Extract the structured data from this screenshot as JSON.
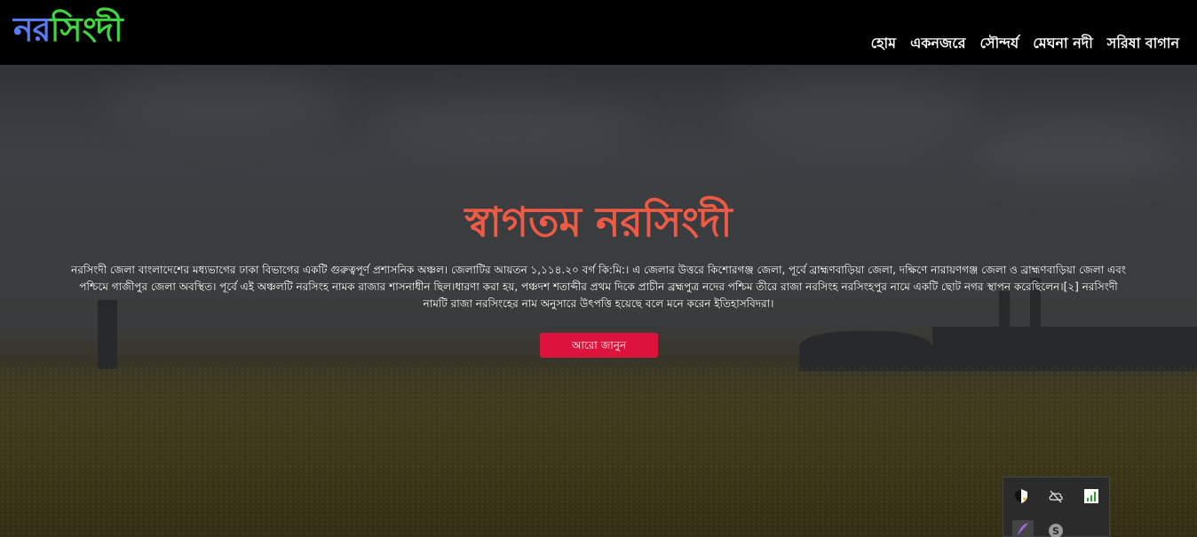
{
  "brand": {
    "part1": "নর",
    "part2": "সিংদী"
  },
  "nav": {
    "items": [
      {
        "label": "হোম"
      },
      {
        "label": "একনজরে"
      },
      {
        "label": "সৌন্দর্য"
      },
      {
        "label": "মেঘনা নদী"
      },
      {
        "label": "সরিষা বাগান"
      }
    ]
  },
  "hero": {
    "title": "স্বাগতম নরসিংদী",
    "description": "নরসিংদী জেলা বাংলাদেশের মধ্যভাগের ঢাকা বিভাগের একটি গুরুত্বপূর্ণ প্রশাসনিক অঞ্চল। জেলাটির আয়তন ১,১১৪.২০ বর্গ কি:মি:। এ জেলার উত্তরে কিশোরগঞ্জ জেলা, পূর্বে ব্রাহ্মণবাড়িয়া জেলা, দক্ষিণে নারায়ণগঞ্জ জেলা ও ব্রাহ্মণবাড়িয়া জেলা এবং পশ্চিমে গাজীপুর জেলা অবস্থিত। পূর্বে এই অঞ্চলটি নরসিংহ নামক রাজার শাসনাধীন ছিল।ধারণা করা হয়, পঞ্চদশ শতাব্দীর প্রথম দিকে প্রাচীন ব্রহ্মপুত্র নদের পশ্চিম তীরে রাজা নরসিংহ নরসিংহপুর নামে একটি ছোট নগর স্থাপন করেছিলেন।[২] নরসিংদী নামটি রাজা নরসিংহের নাম অনুসারে উৎপত্তি হয়েছে বলে মনে করেন ইতিহাসবিদরা।",
    "button_label": "আরো জানুন"
  },
  "colors": {
    "brand_part1": "#5b7cf0",
    "brand_part2": "#3fd63f",
    "title": "#ef5a44",
    "button": "#dc143c"
  },
  "tray": {
    "icons": [
      "security-shield-icon",
      "cloud-offline-icon",
      "network-signal-icon",
      "feather-pen-icon",
      "skype-icon"
    ]
  }
}
